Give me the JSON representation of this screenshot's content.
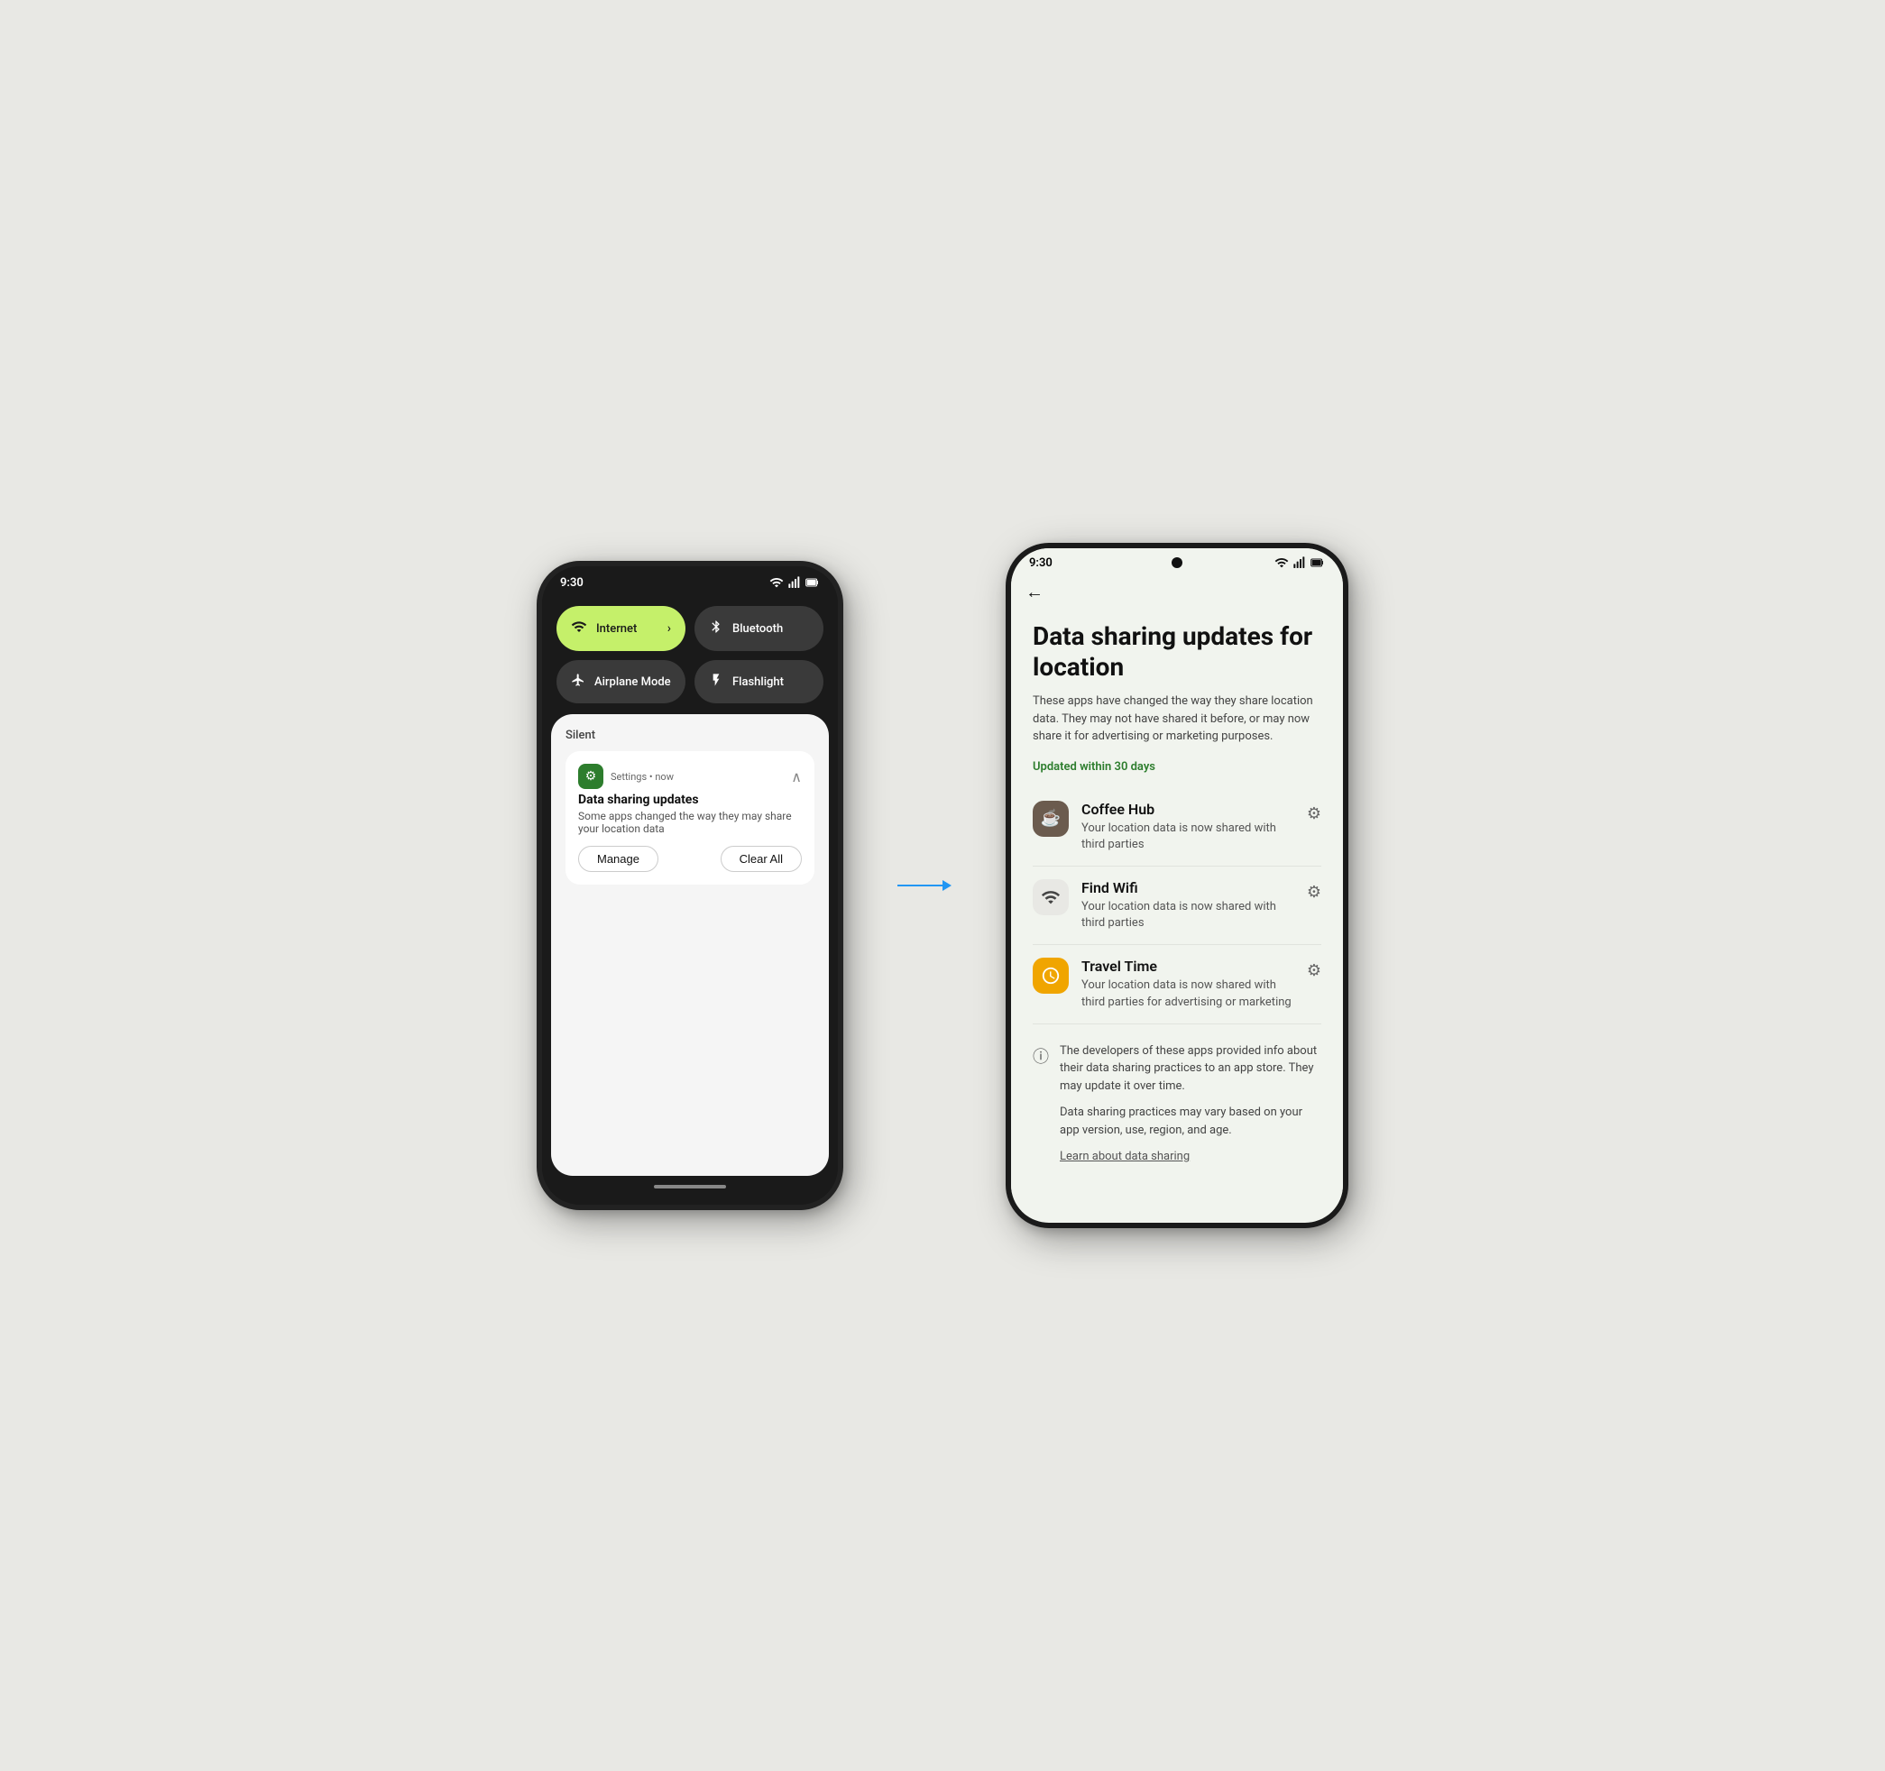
{
  "left_phone": {
    "status_time": "9:30",
    "tiles": [
      {
        "id": "internet",
        "label": "Internet",
        "icon": "wifi",
        "active": true,
        "has_chevron": true
      },
      {
        "id": "bluetooth",
        "label": "Bluetooth",
        "icon": "bluetooth",
        "active": false
      },
      {
        "id": "airplane",
        "label": "Airplane Mode",
        "icon": "airplane",
        "active": false
      },
      {
        "id": "flashlight",
        "label": "Flashlight",
        "icon": "flashlight",
        "active": false
      }
    ],
    "notification": {
      "section_label": "Silent",
      "app_name": "Settings",
      "time": "now",
      "title": "Data sharing updates",
      "body": "Some apps changed the way they may share your location data",
      "action_manage": "Manage",
      "action_clear": "Clear All"
    }
  },
  "right_phone": {
    "status_time": "9:30",
    "page_title": "Data sharing updates for location",
    "page_subtitle": "These apps have changed the way they share location data. They may not have shared it before, or may now share it for advertising or marketing purposes.",
    "updated_label": "Updated within 30 days",
    "apps": [
      {
        "id": "coffee-hub",
        "name": "Coffee Hub",
        "desc": "Your location data is now shared with third parties",
        "icon_type": "coffee"
      },
      {
        "id": "find-wifi",
        "name": "Find Wifi",
        "desc": "Your location data is now shared with third parties",
        "icon_type": "wifi"
      },
      {
        "id": "travel-time",
        "name": "Travel Time",
        "desc": "Your location data is now shared with third parties for advertising or marketing",
        "icon_type": "travel"
      }
    ],
    "info_text_1": "The developers of these apps provided info about their data sharing practices to an app store. They may update it over time.",
    "info_text_2": "Data sharing practices may vary based on your app version, use, region, and age.",
    "learn_link": "Learn about data sharing"
  }
}
